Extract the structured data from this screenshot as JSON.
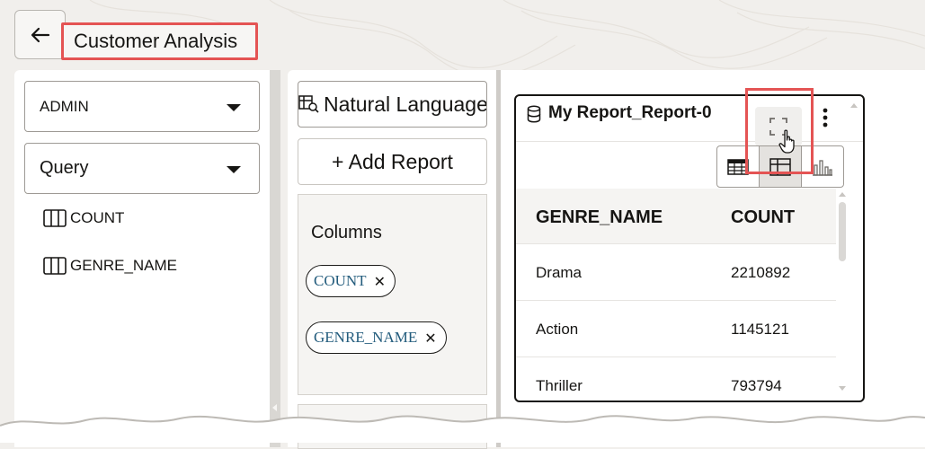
{
  "header": {
    "back_icon": "arrow-left-icon",
    "title": "Customer Analysis"
  },
  "left_panel": {
    "schema_dropdown": "ADMIN",
    "source_dropdown": "Query",
    "columns": [
      "COUNT",
      "GENRE_NAME"
    ],
    "column_icon": "table-columns-icon"
  },
  "middle_panel": {
    "natural_language_label": "Natural Language",
    "add_report_label": "+ Add Report",
    "columns_label": "Columns",
    "chips": [
      "COUNT",
      "GENRE_NAME"
    ]
  },
  "report": {
    "title": "My Report_Report-0",
    "icons": [
      "database-icon",
      "expand-icon",
      "more-vertical-icon",
      "table-view-icon",
      "pivot-view-icon",
      "chart-view-icon"
    ],
    "active_view": "pivot",
    "table": {
      "headers": [
        "GENRE_NAME",
        "COUNT"
      ],
      "rows": [
        [
          "Drama",
          "2210892"
        ],
        [
          "Action",
          "1145121"
        ],
        [
          "Thriller",
          "793794"
        ]
      ]
    }
  },
  "colors": {
    "highlight": "#e45454",
    "chip_text": "#235c7d",
    "background": "#f1efec"
  }
}
